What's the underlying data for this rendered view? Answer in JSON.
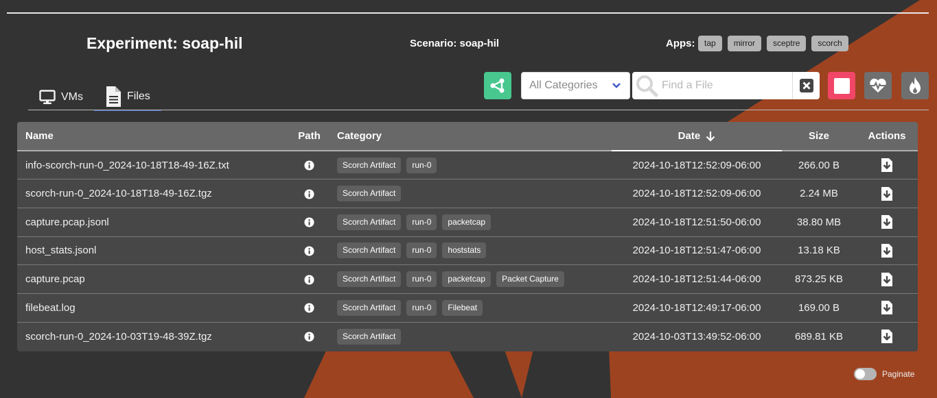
{
  "theme": {
    "background": "#333333",
    "accent_orange": "#9e4320",
    "success": "#48c78e",
    "danger": "#f14668"
  },
  "header": {
    "experiment_label": "Experiment: soap-hil",
    "scenario_label": "Scenario: soap-hil",
    "apps_label": "Apps:",
    "apps": [
      "tap",
      "mirror",
      "sceptre",
      "scorch"
    ]
  },
  "tabs": [
    {
      "label": "VMs",
      "icon": "monitor-icon",
      "active": false
    },
    {
      "label": "Files",
      "icon": "file-icon",
      "active": true
    }
  ],
  "toolbar": {
    "category_select": "All Categories",
    "search_placeholder": "Find a File",
    "search_value": ""
  },
  "table": {
    "columns": [
      "Name",
      "Path",
      "Category",
      "Date",
      "Size",
      "Actions"
    ],
    "sort": {
      "column": "Date",
      "direction": "descending"
    },
    "rows": [
      {
        "name": "info-scorch-run-0_2024-10-18T18-49-16Z.txt",
        "categories": [
          "Scorch Artifact",
          "run-0"
        ],
        "date": "2024-10-18T12:52:09-06:00",
        "size": "266.00 B"
      },
      {
        "name": "scorch-run-0_2024-10-18T18-49-16Z.tgz",
        "categories": [
          "Scorch Artifact"
        ],
        "date": "2024-10-18T12:52:09-06:00",
        "size": "2.24 MB"
      },
      {
        "name": "capture.pcap.jsonl",
        "categories": [
          "Scorch Artifact",
          "run-0",
          "packetcap"
        ],
        "date": "2024-10-18T12:51:50-06:00",
        "size": "38.80 MB"
      },
      {
        "name": "host_stats.jsonl",
        "categories": [
          "Scorch Artifact",
          "run-0",
          "hoststats"
        ],
        "date": "2024-10-18T12:51:47-06:00",
        "size": "13.18 KB"
      },
      {
        "name": "capture.pcap",
        "categories": [
          "Scorch Artifact",
          "run-0",
          "packetcap",
          "Packet Capture"
        ],
        "date": "2024-10-18T12:51:44-06:00",
        "size": "873.25 KB"
      },
      {
        "name": "filebeat.log",
        "categories": [
          "Scorch Artifact",
          "run-0",
          "Filebeat"
        ],
        "date": "2024-10-18T12:49:17-06:00",
        "size": "169.00 B"
      },
      {
        "name": "scorch-run-0_2024-10-03T19-48-39Z.tgz",
        "categories": [
          "Scorch Artifact"
        ],
        "date": "2024-10-03T13:49:52-06:00",
        "size": "689.81 KB"
      }
    ]
  },
  "footer": {
    "paginate_label": "Paginate",
    "paginate_on": false
  }
}
